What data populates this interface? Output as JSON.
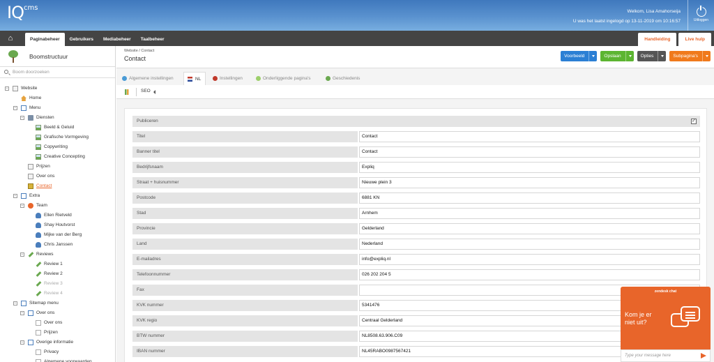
{
  "header": {
    "logo_main": "IQ",
    "logo_sup": "cms",
    "welcome": "Welkom, Lisa Amahorseija",
    "last_login": "U was het laatst ingelogd op 13-11-2019 om 10:16:57",
    "logout_label": "Uitloggen"
  },
  "nav": {
    "tabs": [
      "Paginabeheer",
      "Gebruikers",
      "Mediabeheer",
      "Taalbeheer"
    ],
    "active_tab": "Paginabeheer",
    "right_tabs": [
      "Handleiding",
      "Live hulp"
    ]
  },
  "sidebar": {
    "title": "Boomstructuur",
    "search_placeholder": "Boom doorzoeken",
    "tree": [
      {
        "label": "Website",
        "icon": "page-icon",
        "level": 0,
        "expandable": true
      },
      {
        "label": "Home",
        "icon": "home-icon",
        "level": 1
      },
      {
        "label": "Menu",
        "icon": "menu-icon",
        "level": 1,
        "expandable": true
      },
      {
        "label": "Diensten",
        "icon": "folder-icon",
        "level": 2,
        "expandable": true
      },
      {
        "label": "Beeld & Geluid",
        "icon": "image-icon",
        "level": 3
      },
      {
        "label": "Grafische Vormgeving",
        "icon": "image-icon",
        "level": 3
      },
      {
        "label": "Copywriting",
        "icon": "image-icon",
        "level": 3
      },
      {
        "label": "Creative Concepting",
        "icon": "image-icon",
        "level": 3
      },
      {
        "label": "Prijzen",
        "icon": "page-icon",
        "level": 2
      },
      {
        "label": "Over ons",
        "icon": "page-icon",
        "level": 2
      },
      {
        "label": "Contact",
        "icon": "contact-icon",
        "level": 2,
        "active": true
      },
      {
        "label": "Extra",
        "icon": "menu-icon",
        "level": 1,
        "expandable": true
      },
      {
        "label": "Team",
        "icon": "people-icon",
        "level": 2,
        "expandable": true
      },
      {
        "label": "Ellen Rietveld",
        "icon": "person-icon",
        "level": 3
      },
      {
        "label": "Shay Houtvorst",
        "icon": "person-icon",
        "level": 3
      },
      {
        "label": "Mijke van der Berg",
        "icon": "person-icon",
        "level": 3
      },
      {
        "label": "Chris Janssen",
        "icon": "person-icon",
        "level": 3
      },
      {
        "label": "Reviews",
        "icon": "pen-icon",
        "level": 2,
        "expandable": true
      },
      {
        "label": "Review 1",
        "icon": "pen-icon",
        "level": 3
      },
      {
        "label": "Review 2",
        "icon": "pen-icon",
        "level": 3
      },
      {
        "label": "Review 3",
        "icon": "pen-icon",
        "level": 3,
        "dim": true
      },
      {
        "label": "Review 4",
        "icon": "pen-icon",
        "level": 3,
        "dim": true
      },
      {
        "label": "Sitemap menu",
        "icon": "menu-icon",
        "level": 1,
        "expandable": true
      },
      {
        "label": "Over ons",
        "icon": "menu-icon",
        "level": 2,
        "expandable": true
      },
      {
        "label": "Over ons",
        "icon": "doc-icon",
        "level": 3
      },
      {
        "label": "Prijzen",
        "icon": "doc-icon",
        "level": 3
      },
      {
        "label": "Overige informatie",
        "icon": "menu-icon",
        "level": 2,
        "expandable": true
      },
      {
        "label": "Privacy",
        "icon": "doc-icon",
        "level": 3
      },
      {
        "label": "Algemene voorwaarden",
        "icon": "doc-icon",
        "level": 3
      }
    ]
  },
  "page": {
    "breadcrumb": "Website / Contact",
    "title": "Contact",
    "actions": [
      {
        "label": "Voorbeeld",
        "color": "#2b7fd4"
      },
      {
        "label": "Opslaan",
        "color": "#5cb531"
      },
      {
        "label": "Opties",
        "color": "#555555"
      },
      {
        "label": "Subpagina's",
        "color": "#f07a1c"
      }
    ],
    "tabs": [
      "Algemene instellingen",
      "NL",
      "Instellingen",
      "Onderliggende pagina's",
      "Geschiedenis"
    ],
    "active_tab": "NL",
    "sub_label": "SEO"
  },
  "form": {
    "publish_label": "Publiceren",
    "publish_checked": true,
    "checkmark": "✓",
    "fields": [
      {
        "label": "Titel",
        "value": "Contact"
      },
      {
        "label": "Banner titel",
        "value": "Contact"
      },
      {
        "label": "Bedrijfsnaam",
        "value": "Expliq"
      },
      {
        "label": "Straat + huisnummer",
        "value": "Nieuwe plein 3"
      },
      {
        "label": "Postcode",
        "value": "6881 KN"
      },
      {
        "label": "Stad",
        "value": "Arnhem"
      },
      {
        "label": "Provincie",
        "value": "Gelderland"
      },
      {
        "label": "Land",
        "value": "Nederland"
      },
      {
        "label": "E-mailadres",
        "value": "info@expliq.nl"
      },
      {
        "label": "Telefoonnummer",
        "value": "026 202 204 5"
      },
      {
        "label": "Fax",
        "value": ""
      },
      {
        "label": "KVK nummer",
        "value": "5341476"
      },
      {
        "label": "KVK regio",
        "value": "Centraal Gelderland"
      },
      {
        "label": "BTW nummer",
        "value": "NL8508.63.906.C09"
      },
      {
        "label": "IBAN nummer",
        "value": "NL45RABO0987567421"
      }
    ]
  },
  "chat": {
    "brand": "zendesk chat",
    "message_line1": "Kom je er",
    "message_line2": "niet uit?",
    "placeholder": "Type your message here"
  }
}
